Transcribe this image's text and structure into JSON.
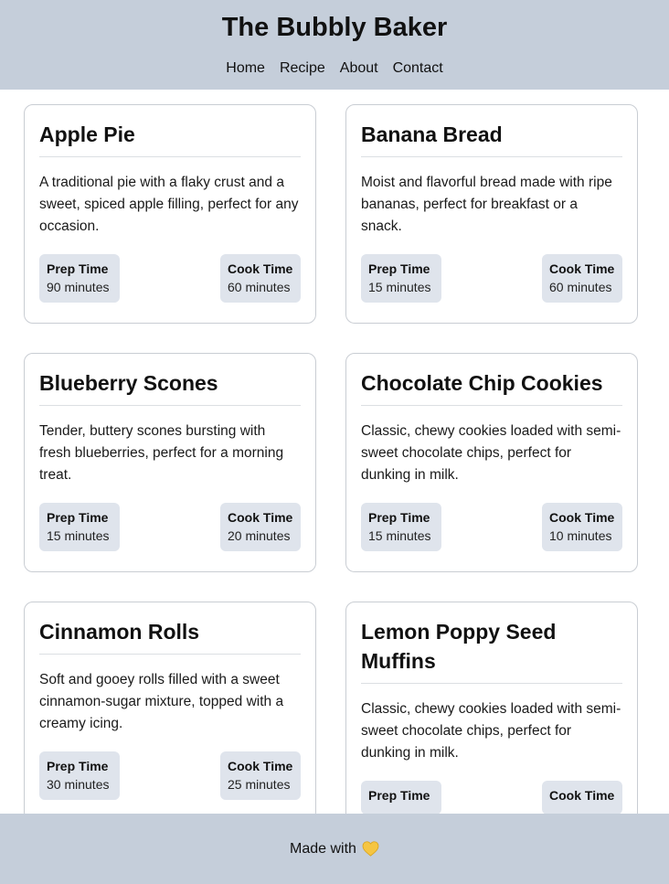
{
  "header": {
    "title": "The Bubbly Baker",
    "nav": [
      "Home",
      "Recipe",
      "About",
      "Contact"
    ]
  },
  "recipes": [
    {
      "title": "Apple Pie",
      "description": "A traditional pie with a flaky crust and a sweet, spiced apple filling, perfect for any occasion.",
      "prep_label": "Prep Time",
      "prep": "90 minutes",
      "cook_label": "Cook Time",
      "cook": "60 minutes"
    },
    {
      "title": "Banana Bread",
      "description": "Moist and flavorful bread made with ripe bananas, perfect for breakfast or a snack.",
      "prep_label": "Prep Time",
      "prep": "15 minutes",
      "cook_label": "Cook Time",
      "cook": "60 minutes"
    },
    {
      "title": "Blueberry Scones",
      "description": "Tender, buttery scones bursting with fresh blueberries, perfect for a morning treat.",
      "prep_label": "Prep Time",
      "prep": "15 minutes",
      "cook_label": "Cook Time",
      "cook": "20 minutes"
    },
    {
      "title": "Chocolate Chip Cookies",
      "description": "Classic, chewy cookies loaded with semi-sweet chocolate chips, perfect for dunking in milk.",
      "prep_label": "Prep Time",
      "prep": "15 minutes",
      "cook_label": "Cook Time",
      "cook": "10 minutes"
    },
    {
      "title": "Cinnamon Rolls",
      "description": "Soft and gooey rolls filled with a sweet cinnamon-sugar mixture, topped with a creamy icing.",
      "prep_label": "Prep Time",
      "prep": "30 minutes",
      "cook_label": "Cook Time",
      "cook": "25 minutes"
    },
    {
      "title": "Lemon Poppy Seed Muffins",
      "description": "Classic, chewy cookies loaded with semi-sweet chocolate chips, perfect for dunking in milk.",
      "prep_label": "Prep Time",
      "prep": "",
      "cook_label": "Cook Time",
      "cook": ""
    }
  ],
  "footer": {
    "text": "Made with",
    "icon": "yellow-heart-icon"
  },
  "colors": {
    "header_bg": "#c5ceda",
    "footer_bg": "#c5ceda",
    "time_box_bg": "#dfe4ec",
    "heart": "#f5c542"
  }
}
